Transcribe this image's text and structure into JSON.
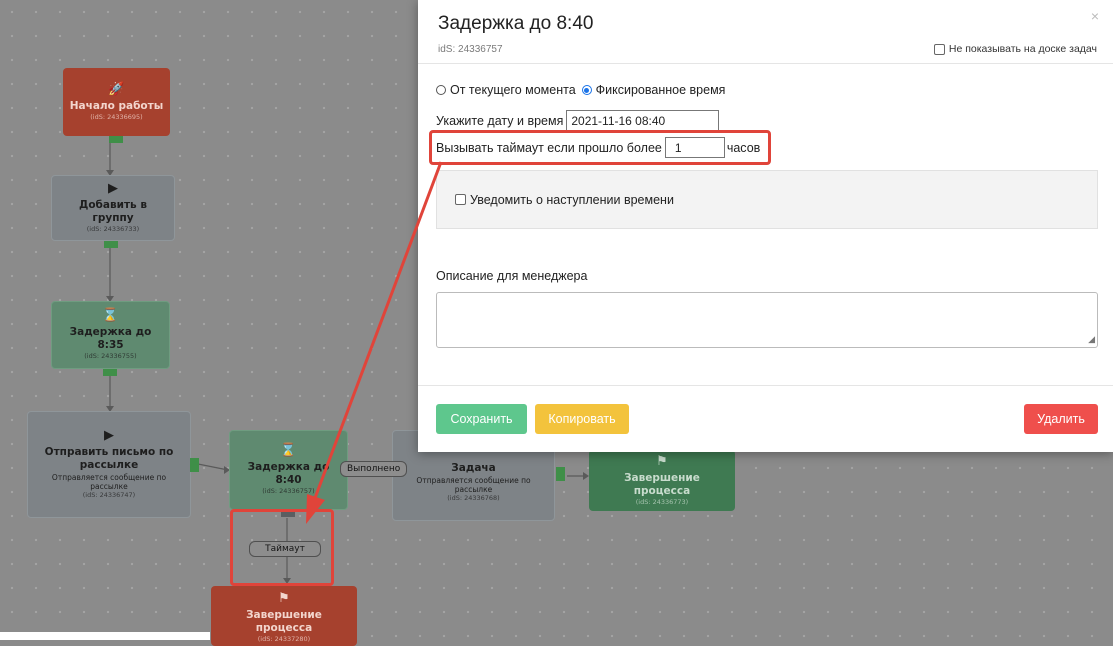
{
  "canvas": {
    "nodes": {
      "start": {
        "title": "Начало работы",
        "ids": "(idS: 24336695)",
        "icon": "rocket-icon"
      },
      "add_group": {
        "title": "Добавить в группу",
        "ids": "(idS: 24336733)",
        "icon": "play-icon"
      },
      "delay_835": {
        "title": "Задержка до 8:35",
        "ids": "(idS: 24336755)",
        "icon": "hourglass-icon"
      },
      "send_letter": {
        "title": "Отправить письмо по рассылке",
        "sub": "Отправляется сообщение по рассылке",
        "ids": "(idS: 24336747)",
        "icon": "play-icon"
      },
      "delay_840": {
        "title": "Задержка до 8:40",
        "ids": "(idS: 24336757)",
        "icon": "hourglass-icon"
      },
      "task": {
        "title": "Задача",
        "sub": "Отправляется сообщение по рассылке",
        "ids": "(idS: 24336768)"
      },
      "end_green": {
        "title": "Завершение процесса",
        "ids": "(idS: 24336773)",
        "icon": "flag-icon"
      },
      "end_red": {
        "title": "Завершение процесса",
        "ids": "(idS: 24337280)",
        "icon": "flag-icon"
      }
    },
    "labels": {
      "done": "Выполнено",
      "timeout": "Таймаут"
    }
  },
  "modal": {
    "title": "Задержка до 8:40",
    "close": "×",
    "ids": "idS: 24336757",
    "hide_board_label": "Не показывать на доске задач",
    "radio_current": "От текущего момента",
    "radio_fixed": "Фиксированное время",
    "datetime_label": "Укажите дату и время",
    "datetime_value": "2021-11-16 08:40",
    "timeout_label": "Вызывать таймаут если прошло более",
    "timeout_value": "1",
    "timeout_unit": "часов",
    "notify_label": "Уведомить о наступлении времени",
    "desc_label": "Описание для менеджера",
    "buttons": {
      "save": "Сохранить",
      "copy": "Копировать",
      "delete": "Удалить"
    }
  },
  "colors": {
    "accent_red": "#e0443a",
    "save": "#5ec78d",
    "copy": "#f3c33c",
    "delete": "#ef4f4c"
  }
}
